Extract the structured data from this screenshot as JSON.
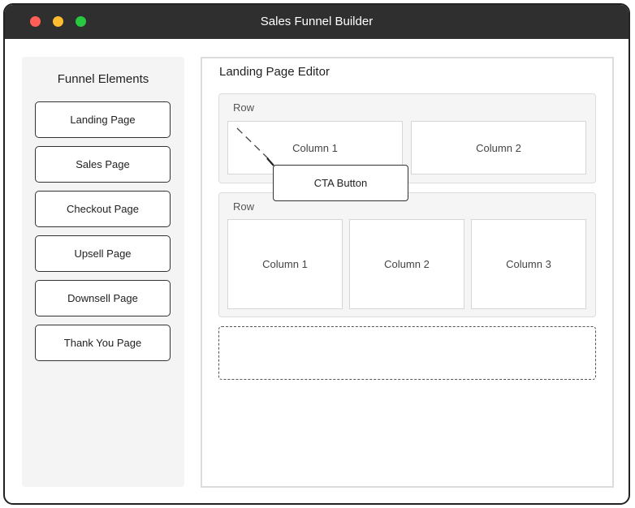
{
  "window": {
    "title": "Sales Funnel Builder"
  },
  "sidebar": {
    "title": "Funnel Elements",
    "items": [
      {
        "label": "Landing Page"
      },
      {
        "label": "Sales Page"
      },
      {
        "label": "Checkout Page"
      },
      {
        "label": "Upsell Page"
      },
      {
        "label": "Downsell Page"
      },
      {
        "label": "Thank You Page"
      }
    ]
  },
  "editor": {
    "title": "Landing Page Editor",
    "rows": [
      {
        "label": "Row",
        "columns": [
          "Column 1",
          "Column 2"
        ]
      },
      {
        "label": "Row",
        "columns": [
          "Column 1",
          "Column 2",
          "Column 3"
        ]
      }
    ],
    "dragging_element": {
      "label": "CTA Button"
    }
  },
  "colors": {
    "titlebar": "#2f2f2f",
    "close": "#ff5f57",
    "minimize": "#febc2e",
    "maximize": "#28c840"
  }
}
